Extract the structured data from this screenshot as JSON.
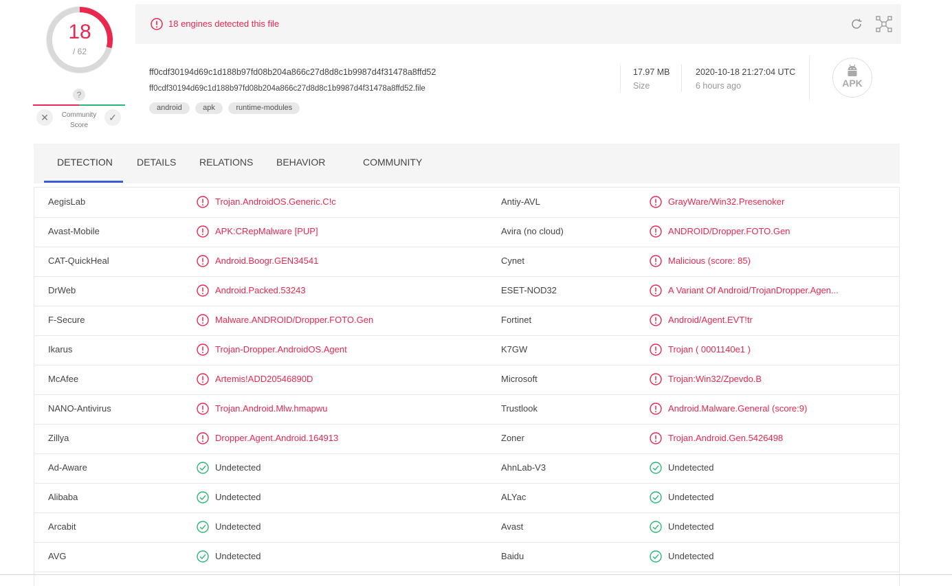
{
  "score": {
    "detected": "18",
    "total": "/ 62",
    "help": "?",
    "community_label_line1": "Community",
    "community_label_line2": "Score"
  },
  "colors": {
    "malicious": "#e8284f",
    "clean": "#2bb673",
    "tab_accent": "#3b5cd6"
  },
  "alert": {
    "text": "18 engines detected this file"
  },
  "file": {
    "hash": "ff0cdf30194d69c1d188b97fd08b204a866c27d8d8c1b9987d4f31478a8ffd52",
    "name": "ff0cdf30194d69c1d188b97fd08b204a866c27d8d8c1b9987d4f31478a8ffd52.file",
    "tags": [
      "android",
      "apk",
      "runtime-modules"
    ],
    "size_value": "17.97 MB",
    "size_label": "Size",
    "date": "2020-10-18 21:27:04 UTC",
    "date_relative": "6 hours ago",
    "type_badge": "APK"
  },
  "tabs": [
    "DETECTION",
    "DETAILS",
    "RELATIONS",
    "BEHAVIOR",
    "COMMUNITY"
  ],
  "detections": [
    [
      {
        "engine": "AegisLab",
        "result": "Trojan.AndroidOS.Generic.C!c",
        "malicious": true
      },
      {
        "engine": "Antiy-AVL",
        "result": "GrayWare/Win32.Presenoker",
        "malicious": true
      }
    ],
    [
      {
        "engine": "Avast-Mobile",
        "result": "APK:CRepMalware [PUP]",
        "malicious": true
      },
      {
        "engine": "Avira (no cloud)",
        "result": "ANDROID/Dropper.FOTO.Gen",
        "malicious": true
      }
    ],
    [
      {
        "engine": "CAT-QuickHeal",
        "result": "Android.Boogr.GEN34541",
        "malicious": true
      },
      {
        "engine": "Cynet",
        "result": "Malicious (score: 85)",
        "malicious": true
      }
    ],
    [
      {
        "engine": "DrWeb",
        "result": "Android.Packed.53243",
        "malicious": true
      },
      {
        "engine": "ESET-NOD32",
        "result": "A Variant Of Android/TrojanDropper.Agen...",
        "malicious": true
      }
    ],
    [
      {
        "engine": "F-Secure",
        "result": "Malware.ANDROID/Dropper.FOTO.Gen",
        "malicious": true
      },
      {
        "engine": "Fortinet",
        "result": "Android/Agent.EVT!tr",
        "malicious": true
      }
    ],
    [
      {
        "engine": "Ikarus",
        "result": "Trojan-Dropper.AndroidOS.Agent",
        "malicious": true
      },
      {
        "engine": "K7GW",
        "result": "Trojan ( 0001140e1 )",
        "malicious": true
      }
    ],
    [
      {
        "engine": "McAfee",
        "result": "Artemis!ADD20546890D",
        "malicious": true
      },
      {
        "engine": "Microsoft",
        "result": "Trojan:Win32/Zpevdo.B",
        "malicious": true
      }
    ],
    [
      {
        "engine": "NANO-Antivirus",
        "result": "Trojan.Android.Mlw.hmapwu",
        "malicious": true
      },
      {
        "engine": "Trustlook",
        "result": "Android.Malware.General (score:9)",
        "malicious": true
      }
    ],
    [
      {
        "engine": "Zillya",
        "result": "Dropper.Agent.Android.164913",
        "malicious": true
      },
      {
        "engine": "Zoner",
        "result": "Trojan.Android.Gen.5426498",
        "malicious": true
      }
    ],
    [
      {
        "engine": "Ad-Aware",
        "result": "Undetected",
        "malicious": false
      },
      {
        "engine": "AhnLab-V3",
        "result": "Undetected",
        "malicious": false
      }
    ],
    [
      {
        "engine": "Alibaba",
        "result": "Undetected",
        "malicious": false
      },
      {
        "engine": "ALYac",
        "result": "Undetected",
        "malicious": false
      }
    ],
    [
      {
        "engine": "Arcabit",
        "result": "Undetected",
        "malicious": false
      },
      {
        "engine": "Avast",
        "result": "Undetected",
        "malicious": false
      }
    ],
    [
      {
        "engine": "AVG",
        "result": "Undetected",
        "malicious": false
      },
      {
        "engine": "Baidu",
        "result": "Undetected",
        "malicious": false
      }
    ]
  ]
}
